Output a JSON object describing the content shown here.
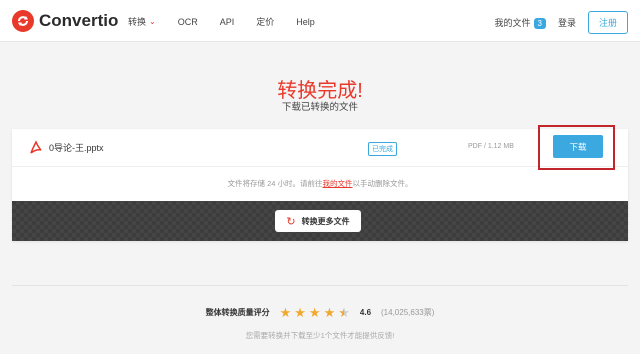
{
  "header": {
    "logo_text": "Convertio",
    "nav": [
      "转换",
      "OCR",
      "API",
      "定价",
      "Help"
    ],
    "my_files_label": "我的文件",
    "my_files_count": "3",
    "login_label": "登录",
    "signup_label": "注册"
  },
  "main": {
    "title": "转换完成!",
    "subtitle": "下载已转换的文件"
  },
  "file": {
    "name": "0导论-王.pptx",
    "status": "已完成",
    "info": "PDF / 1.12 MB",
    "download_label": "下载"
  },
  "note": {
    "before": "文件将存储 24 小时。请前往",
    "link": "我的文件",
    "after": "以手动删除文件。"
  },
  "convert_more_label": "转换更多文件",
  "rating": {
    "label": "整体转换质量评分",
    "stars": 4.5,
    "score": "4.6",
    "count": "(14,025,633票)",
    "feedback": "您需要转换并下载至少1个文件才能提供反馈!"
  },
  "colors": {
    "brand_red": "#e8392b",
    "accent_blue": "#3ba8e0",
    "star": "#f0a92d",
    "highlight": "#c0262c"
  },
  "icons": {
    "logo": "convertio-logo-icon",
    "file": "pdf-icon",
    "refresh": "refresh-icon",
    "chevron": "chevron-down-icon"
  }
}
